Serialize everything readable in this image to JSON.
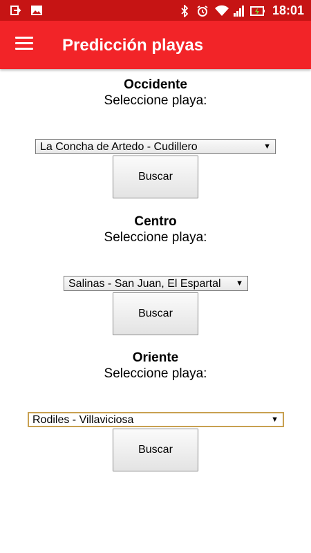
{
  "status_bar": {
    "time": "18:01",
    "left_icons": [
      "usb-transfer-icon",
      "image-notification-icon"
    ],
    "right_icons": [
      "bluetooth-icon",
      "alarm-icon",
      "wifi-icon",
      "cell-signal-icon",
      "battery-charging-icon"
    ]
  },
  "app_bar": {
    "title": "Predicción playas",
    "menu_icon": "hamburger-menu-icon"
  },
  "sections": [
    {
      "region": "Occidente",
      "prompt": "Seleccione playa:",
      "selected": "La Concha de Artedo - Cudillero",
      "button": "Buscar"
    },
    {
      "region": "Centro",
      "prompt": "Seleccione playa:",
      "selected": "Salinas - San Juan, El Espartal",
      "button": "Buscar"
    },
    {
      "region": "Oriente",
      "prompt": "Seleccione playa:",
      "selected": "Rodiles - Villaviciosa",
      "button": "Buscar"
    }
  ],
  "colors": {
    "status_bar": "#c61414",
    "app_bar": "#f22428",
    "focus_border": "#c8a050"
  }
}
